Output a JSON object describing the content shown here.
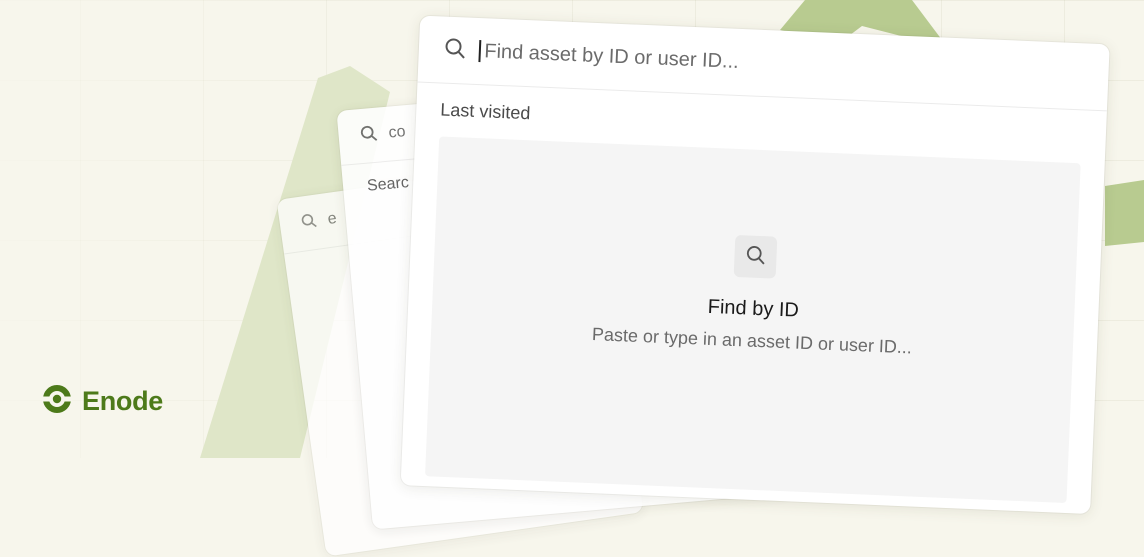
{
  "colors": {
    "brand_green": "#4d7a1a",
    "bg_shape_green": "#b8cb90"
  },
  "back_card_3": {
    "search_text": "e"
  },
  "back_card_2": {
    "search_text": "co",
    "section_label": "Searc"
  },
  "main_card": {
    "search": {
      "icon": "search-icon",
      "placeholder": "Find asset by ID or user ID..."
    },
    "section_label": "Last visited",
    "empty_state": {
      "icon": "search-icon",
      "title": "Find by ID",
      "subtitle": "Paste or type in an asset ID or user ID..."
    }
  },
  "brand": {
    "name": "Enode",
    "icon": "enode-logo-icon"
  }
}
